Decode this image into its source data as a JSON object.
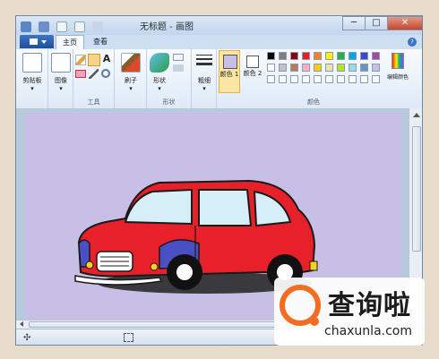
{
  "window": {
    "title": "无标题 - 画图",
    "minimize_glyph": "─",
    "maximize_glyph": "□",
    "close_glyph": "✕"
  },
  "tabs": [
    {
      "label": "主页",
      "active": true
    },
    {
      "label": "查看",
      "active": false
    }
  ],
  "help_glyph": "?",
  "ribbon": {
    "clipboard_label": "剪贴板",
    "image_label": "图像",
    "tools_group_label": "工具",
    "text_tool_glyph": "A",
    "brushes_label": "刷子",
    "shapes_label": "形状",
    "shapes_group_label": "形状",
    "size_label": "粗细",
    "color1_label": "颜色 1",
    "color2_label": "颜色 2",
    "colors_group_label": "颜色",
    "edit_colors_label": "编辑颜色"
  },
  "palette": [
    [
      "#000000",
      "#7f7f7f",
      "#880015",
      "#ed1c24",
      "#ff7f27",
      "#fff200",
      "#22b14c",
      "#00a2e8",
      "#3f48cc",
      "#a349a4"
    ],
    [
      "#ffffff",
      "#c3c3c3",
      "#b97a57",
      "#ffaec9",
      "#ffc90e",
      "#efe4b0",
      "#b5e61d",
      "#99d9ea",
      "#7092be",
      "#c8bfe7"
    ],
    [
      "#ffffff",
      "#ffffff",
      "#ffffff",
      "#ffffff",
      "#ffffff",
      "#ffffff",
      "#ffffff",
      "#ffffff",
      "#ffffff",
      "#ffffff"
    ]
  ],
  "colors": {
    "color1": "#c8bfe7",
    "color2": "#ffffff",
    "canvas_background": "#c8bfe7",
    "car_body": "#e8202a",
    "car_window": "#d6eef7",
    "car_accent": "#4b4fc4"
  },
  "watermark": {
    "text": "查询啦",
    "subtext": "chaxunla.com"
  }
}
